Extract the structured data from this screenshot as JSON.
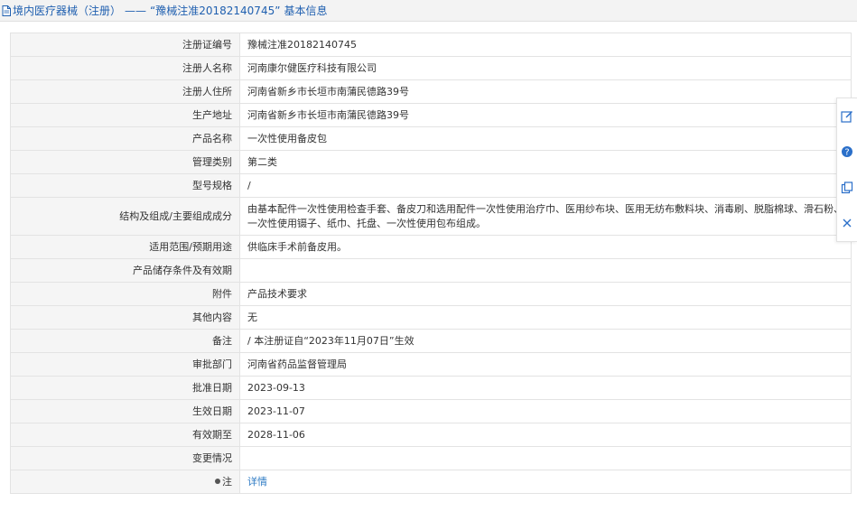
{
  "header": {
    "category": "境内医疗器械（注册）",
    "separator": "——",
    "registration_quoted": "“豫械注准20182140745”",
    "suffix": "基本信息"
  },
  "rows": [
    {
      "label": "注册证编号",
      "value": "豫械注准20182140745"
    },
    {
      "label": "注册人名称",
      "value": "河南康尔健医疗科技有限公司"
    },
    {
      "label": "注册人住所",
      "value": "河南省新乡市长垣市南蒲民德路39号"
    },
    {
      "label": "生产地址",
      "value": "河南省新乡市长垣市南蒲民德路39号"
    },
    {
      "label": "产品名称",
      "value": "一次性使用备皮包"
    },
    {
      "label": "管理类别",
      "value": "第二类"
    },
    {
      "label": "型号规格",
      "value": "/"
    },
    {
      "label": "结构及组成/主要组成成分",
      "value": "由基本配件一次性使用检查手套、备皮刀和选用配件一次性使用治疗巾、医用纱布块、医用无纺布敷料块、消毒刷、脱脂棉球、滑石粉、一次性使用镊子、纸巾、托盘、一次性使用包布组成。"
    },
    {
      "label": "适用范围/预期用途",
      "value": "供临床手术前备皮用。"
    },
    {
      "label": "产品储存条件及有效期",
      "value": ""
    },
    {
      "label": "附件",
      "value": "产品技术要求"
    },
    {
      "label": "其他内容",
      "value": "无"
    },
    {
      "label": "备注",
      "value": "/ 本注册证自“2023年11月07日”生效"
    },
    {
      "label": "审批部门",
      "value": "河南省药品监督管理局"
    },
    {
      "label": "批准日期",
      "value": "2023-09-13"
    },
    {
      "label": "生效日期",
      "value": "2023-11-07"
    },
    {
      "label": "有效期至",
      "value": "2028-11-06"
    },
    {
      "label": "变更情况",
      "value": ""
    },
    {
      "label": "注",
      "value": "详情"
    }
  ],
  "toolbar_icons": [
    "edit-icon",
    "help-icon",
    "copy-icon",
    "close-icon"
  ],
  "colors": {
    "accent": "#2060b0",
    "link": "#2e7bc4",
    "label_bg": "#f5f5f5",
    "border": "#e3e3e3"
  }
}
